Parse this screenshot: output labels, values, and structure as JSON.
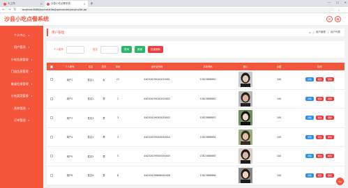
{
  "browser": {
    "tabs": [
      {
        "label": "人工作"
      },
      {
        "label": "沙县小吃点餐系统"
      }
    ],
    "new_tab": "+",
    "url": "localhost:8080/jsp/vue/#/tbl/jsp/modules/yonghu/list.jsp"
  },
  "app": {
    "title": "沙县小吃点餐系统",
    "header_icons": [
      "close-icon",
      "user-icon"
    ]
  },
  "sidebar": {
    "items": [
      {
        "label": "个人中心"
      },
      {
        "label": "用户管理"
      },
      {
        "label": "小吃信息管理"
      },
      {
        "label": "门店信息管理"
      },
      {
        "label": "餐桌信息管理"
      },
      {
        "label": "小吃类型管理"
      },
      {
        "label": "系统管理"
      },
      {
        "label": "订单管理"
      }
    ]
  },
  "page": {
    "title": "用户管理",
    "breadcrumb": [
      "⌂",
      "/",
      "用户管理",
      "/",
      "用户列表"
    ]
  },
  "search": {
    "account_label": "个人账号",
    "name_label": "姓名",
    "query_btn": "查询",
    "add_btn": "新增",
    "batch_delete_btn": "批量删除"
  },
  "table": {
    "headers": [
      "个人账号",
      "姓名",
      "性别",
      "年龄",
      "身份证号码",
      "手机号码",
      "照片",
      "余额",
      "操作"
    ],
    "rows": [
      {
        "account": "用户1",
        "name": "姓名1",
        "sex": "女",
        "age": "22",
        "id": "440300199101010001",
        "phone": "13823888881",
        "balance": "100"
      },
      {
        "account": "用户2",
        "name": "姓名2",
        "sex": "男",
        "age": "2",
        "id": "440300199202020002",
        "phone": "13823888882",
        "balance": "100"
      },
      {
        "account": "用户3",
        "name": "姓名3",
        "sex": "男",
        "age": "3",
        "id": "440300199303030003",
        "phone": "13823888883",
        "balance": "100"
      },
      {
        "account": "用户4",
        "name": "姓名4",
        "sex": "男",
        "age": "4",
        "id": "440300199404040004",
        "phone": "13823888884",
        "balance": "100"
      },
      {
        "account": "用户5",
        "name": "姓名5",
        "sex": "男",
        "age": "5",
        "id": "440300199505050005",
        "phone": "13823888885",
        "balance": "100"
      },
      {
        "account": "用户6",
        "name": "姓名6",
        "sex": "男",
        "age": "6",
        "id": "440300199606060006",
        "phone": "13823888886",
        "balance": "100"
      }
    ],
    "ops": {
      "detail": "详情",
      "edit": "修改",
      "delete": "删除"
    }
  },
  "top_btn": "Top",
  "colors": {
    "accent": "#f4553b",
    "green": "#2fb56a",
    "blue": "#2d8ff0",
    "red": "#f03c3c"
  }
}
